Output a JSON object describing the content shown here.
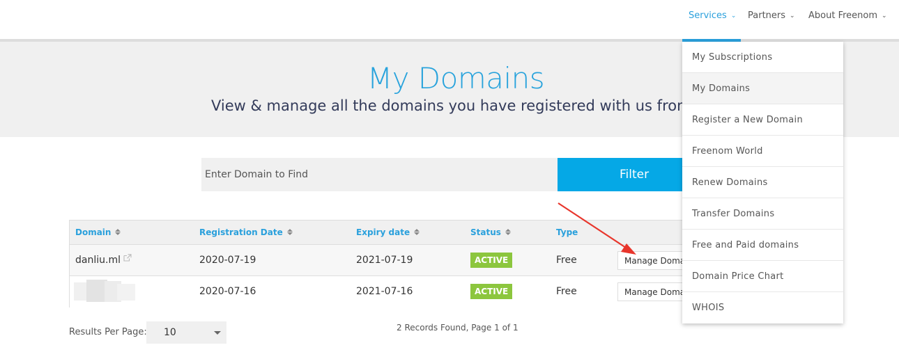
{
  "nav": {
    "items": [
      {
        "label": "Services",
        "active": true
      },
      {
        "label": "Partners",
        "active": false
      },
      {
        "label": "About Freenom",
        "active": false
      }
    ],
    "accent_color": "#2aa0dc"
  },
  "hero": {
    "title": "My Domains",
    "subtitle": "View & manage all the domains you have registered with us from here"
  },
  "filter": {
    "placeholder": "Enter Domain to Find",
    "button_label": "Filter",
    "button_color": "#05a8e6"
  },
  "table": {
    "columns": [
      "Domain",
      "Registration Date",
      "Expiry date",
      "Status",
      "Type"
    ],
    "rows": [
      {
        "domain": "danliu.ml",
        "registration_date": "2020-07-19",
        "expiry_date": "2021-07-19",
        "status": "ACTIVE",
        "type": "Free",
        "action": "Manage Domain"
      },
      {
        "domain": "",
        "registration_date": "2020-07-16",
        "expiry_date": "2021-07-16",
        "status": "ACTIVE",
        "type": "Free",
        "action": "Manage Domain"
      }
    ],
    "status_color": "#8cc63e"
  },
  "pagination": {
    "results_per_page_label": "Results Per Page:",
    "results_per_page_value": "10",
    "records_text": "2 Records Found, Page 1 of 1"
  },
  "services_menu": {
    "items": [
      {
        "label": "My Subscriptions",
        "selected": false
      },
      {
        "label": "My Domains",
        "selected": true
      },
      {
        "label": "Register a New Domain",
        "selected": false
      },
      {
        "label": "Freenom World",
        "selected": false
      },
      {
        "label": "Renew Domains",
        "selected": false
      },
      {
        "label": "Transfer Domains",
        "selected": false
      },
      {
        "label": "Free and Paid domains",
        "selected": false
      },
      {
        "label": "Domain Price Chart",
        "selected": false
      },
      {
        "label": "WHOIS",
        "selected": false
      }
    ]
  },
  "annotation": {
    "icon": "red-arrow-icon",
    "color": "#e8362c"
  }
}
